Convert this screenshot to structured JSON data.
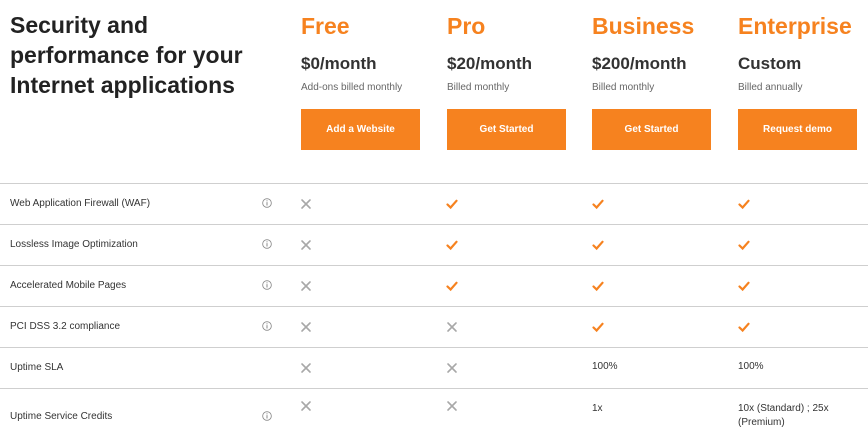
{
  "headline": "Security and performance for your Internet applications",
  "colors": {
    "accent": "#f6821f",
    "cross": "#a8a8a8",
    "divider": "#cfcfcf"
  },
  "plans": [
    {
      "name": "Free",
      "price": "$0/month",
      "note": "Add-ons billed monthly",
      "cta": "Add a Website"
    },
    {
      "name": "Pro",
      "price": "$20/month",
      "note": "Billed monthly",
      "cta": "Get Started"
    },
    {
      "name": "Business",
      "price": "$200/month",
      "note": "Billed monthly",
      "cta": "Get Started"
    },
    {
      "name": "Enterprise",
      "price": "Custom",
      "note": "Billed annually",
      "cta": "Request demo"
    }
  ],
  "features": [
    {
      "label": "Web Application Firewall (WAF)",
      "info": true,
      "values": [
        "cross-icon",
        "check-icon",
        "check-icon",
        "check-icon"
      ]
    },
    {
      "label": "Lossless Image Optimization",
      "info": true,
      "values": [
        "cross-icon",
        "check-icon",
        "check-icon",
        "check-icon"
      ]
    },
    {
      "label": "Accelerated Mobile Pages",
      "info": true,
      "values": [
        "cross-icon",
        "check-icon",
        "check-icon",
        "check-icon"
      ]
    },
    {
      "label": "PCI DSS 3.2 compliance",
      "info": true,
      "values": [
        "cross-icon",
        "cross-icon",
        "check-icon",
        "check-icon"
      ]
    },
    {
      "label": "Uptime SLA",
      "info": false,
      "values": [
        "cross-icon",
        "cross-icon",
        "100%",
        "100%"
      ]
    },
    {
      "label": "Uptime Service Credits",
      "info": true,
      "values": [
        "cross-icon",
        "cross-icon",
        "1x",
        "10x (Standard) ; 25x (Premium)"
      ]
    }
  ]
}
